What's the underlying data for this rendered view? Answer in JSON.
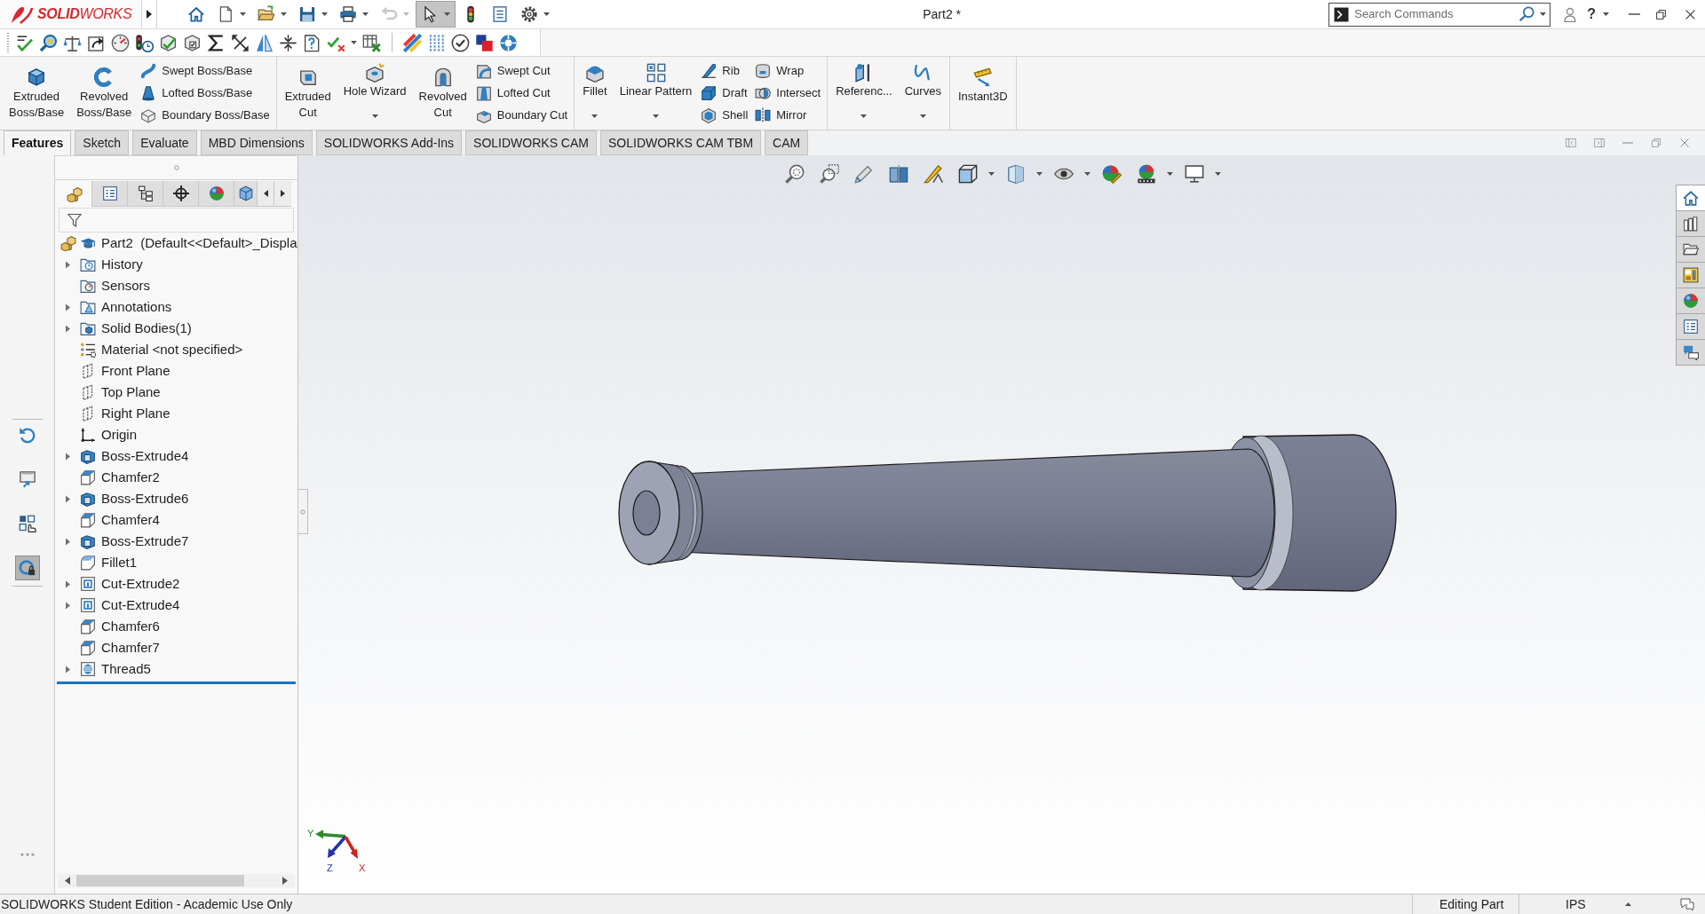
{
  "title_bar": {
    "logo_text": "**SOLID**WORKS",
    "quick_access": [
      {
        "selected": false,
        "disabled": false
      },
      {
        "selected": false,
        "disabled": false
      },
      {
        "selected": false,
        "disabled": false
      },
      {
        "selected": false,
        "disabled": false
      },
      {
        "selected": false,
        "disabled": false
      },
      {
        "selected": false,
        "disabled": true
      },
      {
        "selected": true,
        "disabled": false
      },
      {
        "selected": false,
        "disabled": false
      },
      {
        "selected": false,
        "disabled": false
      },
      {
        "selected": false,
        "disabled": false
      }
    ],
    "document_title": "Part2 *",
    "search": {
      "placeholder": "Search Commands"
    },
    "help": "?"
  },
  "command_manager": {
    "groups": [
      [
        {
          "kind": "large",
          "label": "Extruded Boss/Base"
        },
        {
          "kind": "large",
          "label": "Revolved Boss/Base"
        },
        {
          "kind": "stack",
          "items": [
            {
              "label": "Swept Boss/Base"
            },
            {
              "label": "Lofted Boss/Base"
            },
            {
              "label": "Boundary Boss/Base"
            }
          ]
        }
      ],
      [
        {
          "kind": "large",
          "label": "Extruded Cut"
        },
        {
          "kind": "menu",
          "label": "Hole Wizard"
        },
        {
          "kind": "large",
          "label": "Revolved Cut"
        },
        {
          "kind": "stack",
          "items": [
            {
              "label": "Swept Cut"
            },
            {
              "label": "Lofted Cut"
            },
            {
              "label": "Boundary Cut"
            }
          ]
        }
      ],
      [
        {
          "kind": "menu",
          "label": "Fillet"
        },
        {
          "kind": "menu",
          "label": "Linear Pattern"
        },
        {
          "kind": "stack",
          "items": [
            {
              "label": "Rib"
            },
            {
              "label": "Draft"
            },
            {
              "label": "Shell"
            }
          ]
        },
        {
          "kind": "stack",
          "items": [
            {
              "label": "Wrap"
            },
            {
              "label": "Intersect"
            },
            {
              "label": "Mirror"
            }
          ]
        }
      ],
      [
        {
          "kind": "menu",
          "label": "Referenc..."
        },
        {
          "kind": "menu",
          "label": "Curves"
        }
      ],
      [
        {
          "kind": "large",
          "label": "Instant3D"
        }
      ]
    ]
  },
  "tabs": [
    {
      "label": "Features",
      "selected": true
    },
    {
      "label": "Sketch",
      "selected": false
    },
    {
      "label": "Evaluate",
      "selected": false
    },
    {
      "label": "MBD Dimensions",
      "selected": false
    },
    {
      "label": "SOLIDWORKS Add-Ins",
      "selected": false
    },
    {
      "label": "SOLIDWORKS CAM",
      "selected": false
    },
    {
      "label": "SOLIDWORKS CAM TBM",
      "selected": false
    },
    {
      "label": "CAM",
      "selected": false
    }
  ],
  "left_toolbar": [
    {
      "selected": false
    },
    {
      "selected": false
    },
    {
      "selected": false
    },
    {
      "selected": true
    }
  ],
  "feature_manager": {
    "tabs": [
      {
        "selected": true
      },
      {
        "selected": false
      },
      {
        "selected": false
      },
      {
        "selected": false
      },
      {
        "selected": false
      },
      {
        "selected": false
      }
    ],
    "tree": {
      "label": "Part2  (Default<<Default>_Displa",
      "kind": "part",
      "children": [
        {
          "label": "History",
          "kind": "history",
          "expanded": false
        },
        {
          "label": "Sensors",
          "kind": "sensors"
        },
        {
          "label": "Annotations",
          "kind": "annotations",
          "expanded": false
        },
        {
          "label": "Solid Bodies(1)",
          "kind": "bodies",
          "expanded": false
        },
        {
          "label": "Material <not specified>",
          "kind": "material"
        },
        {
          "label": "Front Plane",
          "kind": "plane"
        },
        {
          "label": "Top Plane",
          "kind": "plane"
        },
        {
          "label": "Right Plane",
          "kind": "plane"
        },
        {
          "label": "Origin",
          "kind": "origin"
        },
        {
          "label": "Boss-Extrude4",
          "kind": "extrude",
          "expanded": false
        },
        {
          "label": "Chamfer2",
          "kind": "chamfer"
        },
        {
          "label": "Boss-Extrude6",
          "kind": "extrude",
          "expanded": false
        },
        {
          "label": "Chamfer4",
          "kind": "chamfer"
        },
        {
          "label": "Boss-Extrude7",
          "kind": "extrude",
          "expanded": false
        },
        {
          "label": "Fillet1",
          "kind": "fillet"
        },
        {
          "label": "Cut-Extrude2",
          "kind": "cut",
          "expanded": false
        },
        {
          "label": "Cut-Extrude4",
          "kind": "cut",
          "expanded": false
        },
        {
          "label": "Chamfer6",
          "kind": "chamfer"
        },
        {
          "label": "Chamfer7",
          "kind": "chamfer"
        },
        {
          "label": "Thread5",
          "kind": "thread",
          "expanded": false
        }
      ]
    }
  },
  "viewport": {
    "triad": {
      "x": "X",
      "y": "Y",
      "z": "Z"
    }
  },
  "task_pane": [
    {
      "selected": true
    },
    {
      "selected": false
    },
    {
      "selected": false
    },
    {
      "selected": false
    },
    {
      "selected": false
    },
    {
      "selected": false
    },
    {
      "selected": false
    }
  ],
  "status_bar": {
    "message": "SOLIDWORKS Student Edition - Academic Use Only",
    "mode": "Editing Part",
    "units": "IPS"
  }
}
